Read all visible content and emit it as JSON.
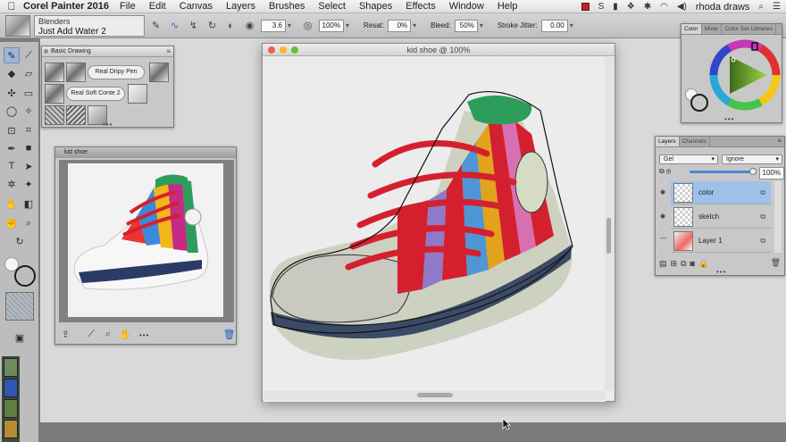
{
  "menubar": {
    "app_name": "Corel Painter 2016",
    "items": [
      "File",
      "Edit",
      "Canvas",
      "Layers",
      "Brushes",
      "Select",
      "Shapes",
      "Effects",
      "Window",
      "Help"
    ],
    "user": "rhoda draws"
  },
  "propbar": {
    "brush_category": "Blenders",
    "brush_variant": "Just Add Water 2",
    "size_value": "3.6",
    "opacity_value": "100%",
    "resat_label": "Resat:",
    "resat_value": "0%",
    "bleed_label": "Bleed:",
    "bleed_value": "50%",
    "stroke_jitter_label": "Stroke Jitter:",
    "stroke_jitter_value": "0.00"
  },
  "basic_drawing": {
    "title": "Basic Drawing",
    "pill_1": "Real Dripy Pen",
    "pill_2": "Real Soft Conte 2"
  },
  "reference": {
    "title": "kid shoe"
  },
  "document": {
    "title": "kid shoe @ 100%"
  },
  "color_panel": {
    "tabs": [
      "Color",
      "Mixer",
      "Color Set Libraries"
    ],
    "accent": "#7fb13a"
  },
  "layers_panel": {
    "tabs": [
      "Layers",
      "Channels"
    ],
    "composite_method": "Gel",
    "preserve": "Ignore",
    "opacity": "100%",
    "layers": [
      {
        "name": "color",
        "selected": true
      },
      {
        "name": "sketch",
        "selected": false
      },
      {
        "name": "Layer 1",
        "selected": false
      }
    ]
  },
  "colors": {
    "selection_blue": "#9ec1ea",
    "shoe_red": "#d4202e",
    "shoe_green": "#2e9d5c"
  }
}
